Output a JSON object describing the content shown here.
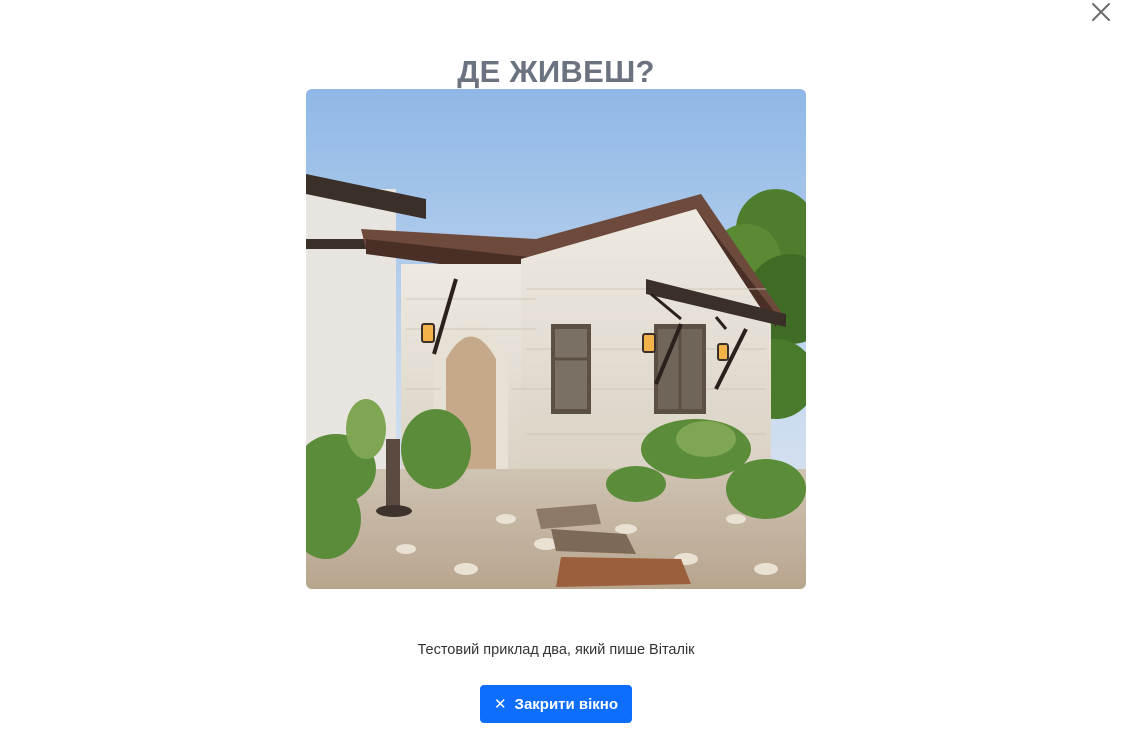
{
  "modal": {
    "title": "ДЕ ЖИВЕШ?",
    "caption": "Тестовий приклад два, який пише Віталік",
    "close_button_label": "Закрити вікно",
    "close_button_icon": "✕",
    "dismiss_icon": "close-icon"
  },
  "image": {
    "subject": "house-photo"
  },
  "colors": {
    "title": "#6b7280",
    "button_bg": "#0d6efd",
    "button_text": "#ffffff",
    "caption": "#333333"
  }
}
